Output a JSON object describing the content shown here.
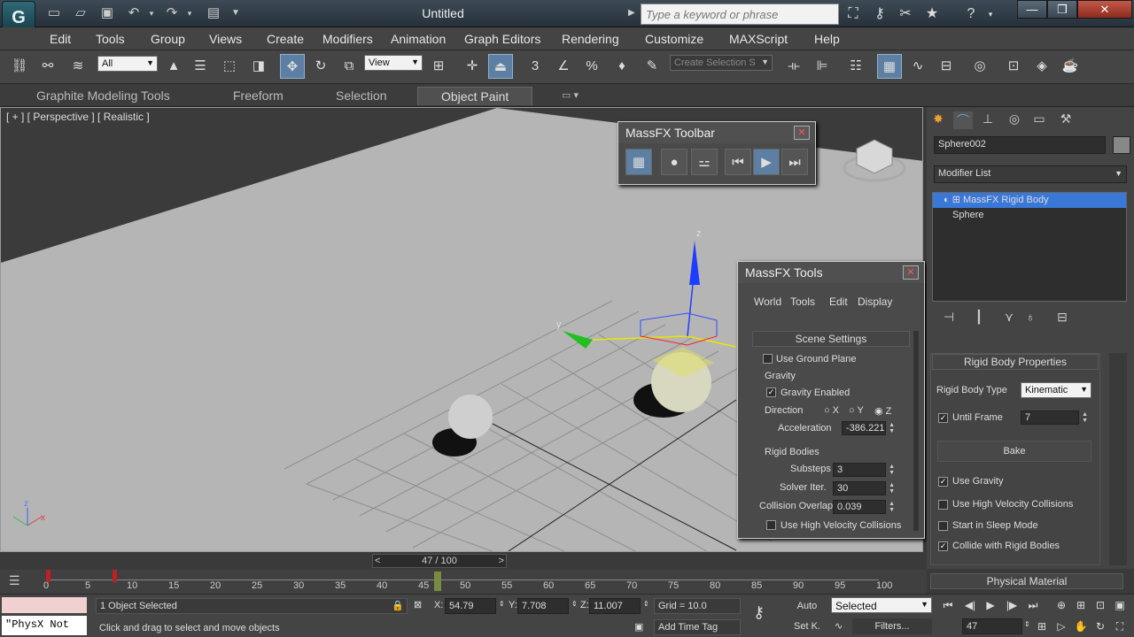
{
  "window": {
    "title": "Untitled",
    "search_placeholder": "Type a keyword or phrase",
    "min": "—",
    "restore": "❐",
    "close": "✕"
  },
  "menus": [
    "Edit",
    "Tools",
    "Group",
    "Views",
    "Create",
    "Modifiers",
    "Animation",
    "Graph Editors",
    "Rendering",
    "Customize",
    "MAXScript",
    "Help"
  ],
  "toolbar": {
    "filter_value": "All",
    "refcoord_value": "View",
    "selset_placeholder": "Create Selection S"
  },
  "ribbon": {
    "tabs": [
      "Graphite Modeling Tools",
      "Freeform",
      "Selection",
      "Object Paint"
    ],
    "active": "Object Paint"
  },
  "viewport": {
    "label": "[ + ] [ Perspective ] [ Realistic ]",
    "gizmo": {
      "z": "z",
      "y": "y"
    },
    "axis": {
      "x": "x",
      "z": "z"
    }
  },
  "massfx_toolbar": {
    "title": "MassFX Toolbar"
  },
  "massfx_tools": {
    "title": "MassFX Tools",
    "tabs": [
      "World",
      "Tools",
      "Edit",
      "Display"
    ],
    "scene_settings": "Scene Settings",
    "use_ground_plane": {
      "label": "Use Ground Plane",
      "checked": false
    },
    "gravity_group": "Gravity",
    "gravity_enabled": {
      "label": "Gravity Enabled",
      "checked": true
    },
    "direction": {
      "label": "Direction",
      "options": [
        "X",
        "Y",
        "Z"
      ],
      "selected": "Z"
    },
    "acceleration": {
      "label": "Acceleration",
      "value": "-386.221"
    },
    "rigid_group": "Rigid Bodies",
    "substeps": {
      "label": "Substeps",
      "value": "3"
    },
    "solver_iter": {
      "label": "Solver Iter.",
      "value": "30"
    },
    "collision_overlap": {
      "label": "Collision Overlap",
      "value": "0.039"
    },
    "high_velocity": {
      "label": "Use High Velocity Collisions",
      "checked": false
    }
  },
  "command_panel": {
    "object_name": "Sphere002",
    "modifier_list": "Modifier List",
    "stack": [
      "MassFX Rigid Body",
      "Sphere"
    ],
    "rigid_body_props": "Rigid Body Properties",
    "rigid_body_type": {
      "label": "Rigid Body Type",
      "value": "Kinematic"
    },
    "until_frame": {
      "label": "Until Frame",
      "value": "7",
      "checked": true
    },
    "bake": "Bake",
    "options": [
      {
        "label": "Use Gravity",
        "checked": true
      },
      {
        "label": "Use High Velocity Collisions",
        "checked": false
      },
      {
        "label": "Start in Sleep Mode",
        "checked": false
      },
      {
        "label": "Collide with Rigid Bodies",
        "checked": true
      }
    ],
    "physical_material": "Physical Material"
  },
  "timeline": {
    "slider": "47 / 100",
    "current": 47,
    "max": 100,
    "ticks": [
      "0",
      "5",
      "10",
      "15",
      "20",
      "25",
      "30",
      "35",
      "40",
      "45",
      "50",
      "55",
      "60",
      "65",
      "70",
      "75",
      "80",
      "85",
      "90",
      "95",
      "100"
    ]
  },
  "status": {
    "maxscript": "\"PhysX Not",
    "selected": "1 Object Selected",
    "prompt": "Click and drag to select and move objects",
    "x_label": "X:",
    "x": "54.79",
    "y_label": "Y:",
    "y": "7.708",
    "z_label": "Z:",
    "z": "11.007",
    "grid": "Grid = 10.0",
    "auto": "Auto",
    "setk": "Set K.",
    "selected_dd": "Selected",
    "filters": "Filters...",
    "add_time_tag": "Add Time Tag",
    "frame": "47"
  }
}
